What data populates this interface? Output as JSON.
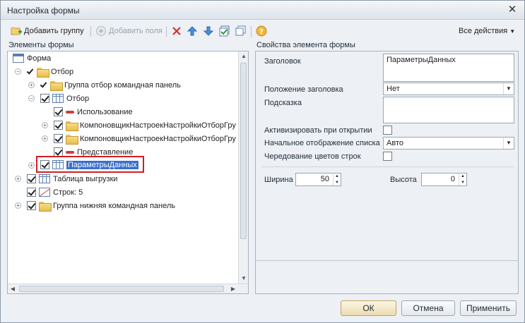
{
  "window": {
    "title": "Настройка формы",
    "close": "✕"
  },
  "toolbar": {
    "add_group": "Добавить группу",
    "add_fields": "Добавить поля",
    "all_actions": "Все действия"
  },
  "left": {
    "section_label": "Элементы формы",
    "tree": [
      {
        "label": "Форма"
      },
      {
        "label": "Отбор"
      },
      {
        "label": "Группа отбор командная панель"
      },
      {
        "label": "Отбор"
      },
      {
        "label": "Использование"
      },
      {
        "label": "КомпоновщикНастроекНастройкиОтборГру"
      },
      {
        "label": "КомпоновщикНастроекНастройкиОтборГру"
      },
      {
        "label": "Представление"
      },
      {
        "label": "ПараметрыДанных"
      },
      {
        "label": "Таблица выгрузки"
      },
      {
        "label": "Строк: 5"
      },
      {
        "label": "Группа нижняя командная панель"
      }
    ]
  },
  "right": {
    "section_label": "Свойства элемента формы",
    "title_label": "Заголовок",
    "title_value": "ПараметрыДанных",
    "title_position_label": "Положение заголовка",
    "title_position_value": "Нет",
    "hint_label": "Подсказка",
    "hint_value": "",
    "activate_label": "Активизировать при открытии",
    "initial_view_label": "Начальное отображение списка",
    "initial_view_value": "Авто",
    "alternate_colors_label": "Чередование цветов строк",
    "width_label": "Ширина",
    "width_value": "50",
    "height_label": "Высота",
    "height_value": "0"
  },
  "buttons": {
    "ok": "ОК",
    "cancel": "Отмена",
    "apply": "Применить"
  },
  "colors": {
    "highlight": "#d11f25",
    "selection": "#3c6fcc"
  }
}
